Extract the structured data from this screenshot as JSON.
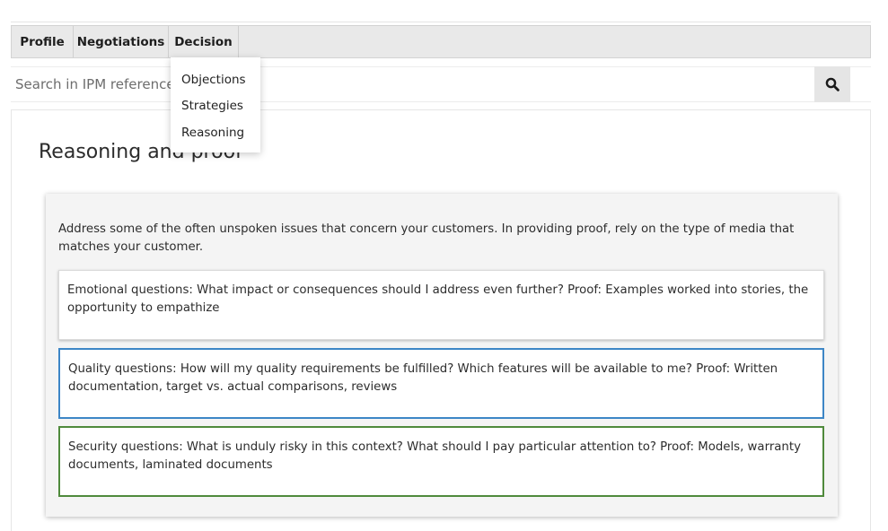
{
  "nav": {
    "tabs": [
      {
        "label": "Profile"
      },
      {
        "label": "Negotiations"
      },
      {
        "label": "Decision"
      }
    ]
  },
  "dropdown": {
    "items": [
      {
        "label": "Objections"
      },
      {
        "label": "Strategies"
      },
      {
        "label": "Reasoning"
      }
    ]
  },
  "search": {
    "placeholder": "Search in IPM reference",
    "icon": "search-icon"
  },
  "main": {
    "title": "Reasoning and proof",
    "intro": "Address some of the often unspoken issues that concern your customers. In providing proof, rely on the type of media that matches your customer.",
    "questions": [
      {
        "text": "Emotional questions: What impact or consequences should I address even further? Proof: Examples worked into stories, the opportunity to empathize",
        "border_color": "#dadada"
      },
      {
        "text": "Quality questions: How will my quality requirements be fulfilled? Which features will be available to me? Proof: Written documentation, target vs. actual comparisons, reviews",
        "border_color": "#3d86c6"
      },
      {
        "text": "Security questions: What is unduly risky in this context? What should I pay particular attention to? Proof: Models, warranty documents, laminated documents",
        "border_color": "#4f8a3c"
      }
    ]
  }
}
